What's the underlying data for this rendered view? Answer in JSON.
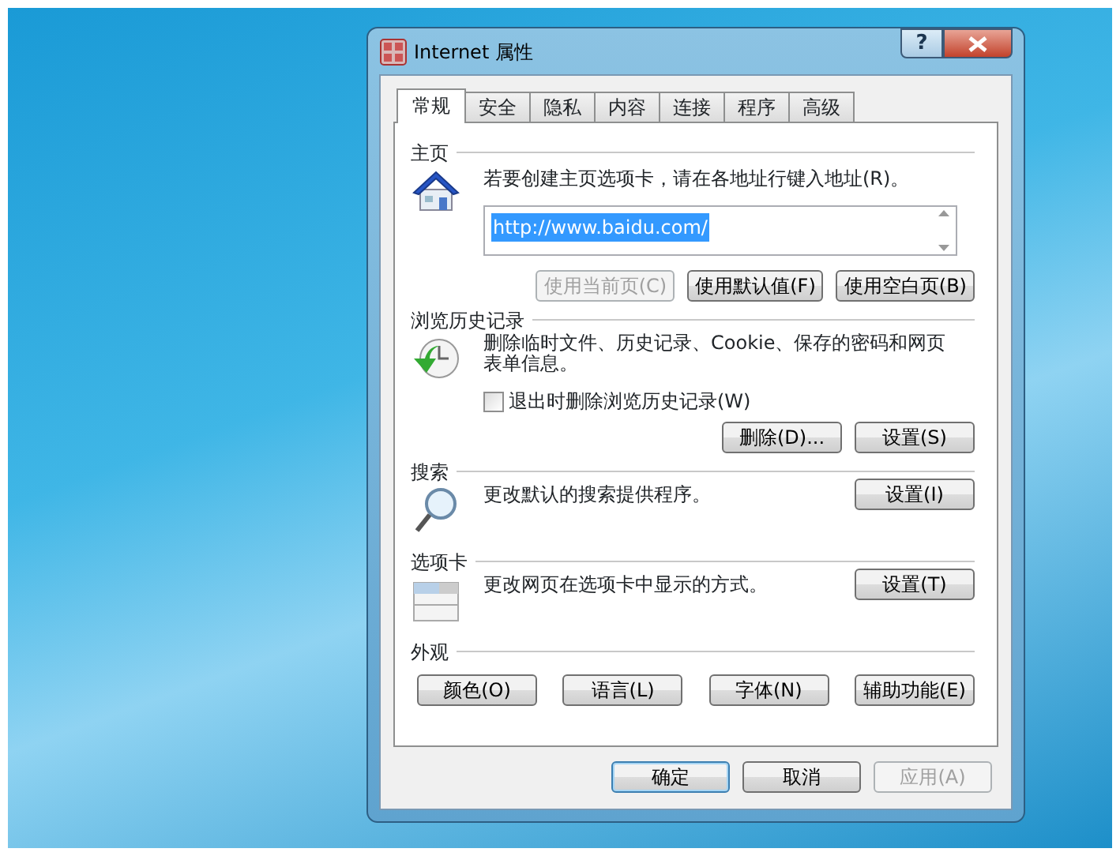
{
  "window": {
    "title": "Internet 属性",
    "help_button": "?"
  },
  "tabs": [
    {
      "label": "常规",
      "selected": true
    },
    {
      "label": "安全",
      "selected": false
    },
    {
      "label": "隐私",
      "selected": false
    },
    {
      "label": "内容",
      "selected": false
    },
    {
      "label": "连接",
      "selected": false
    },
    {
      "label": "程序",
      "selected": false
    },
    {
      "label": "高级",
      "selected": false
    }
  ],
  "sections": [
    {
      "kind": "homepage",
      "heading": "主页",
      "description": "若要创建主页选项卡，请在各地址行键入地址(R)。",
      "url": "http://www.baidu.com/",
      "buttons": [
        {
          "label": "使用当前页(C)",
          "disabled": true
        },
        {
          "label": "使用默认值(F)",
          "disabled": false
        },
        {
          "label": "使用空白页(B)",
          "disabled": false
        }
      ]
    },
    {
      "kind": "history",
      "heading": "浏览历史记录",
      "description": "删除临时文件、历史记录、Cookie、保存的密码和网页表单信息。",
      "checkbox": {
        "label": "退出时删除浏览历史记录(W)",
        "checked": false
      },
      "buttons": [
        {
          "label": "删除(D)...",
          "disabled": false
        },
        {
          "label": "设置(S)",
          "disabled": false
        }
      ]
    },
    {
      "kind": "search",
      "heading": "搜索",
      "description": "更改默认的搜索提供程序。",
      "buttons": [
        {
          "label": "设置(I)",
          "disabled": false
        }
      ]
    },
    {
      "kind": "tabs",
      "heading": "选项卡",
      "description": "更改网页在选项卡中显示的方式。",
      "buttons": [
        {
          "label": "设置(T)",
          "disabled": false
        }
      ]
    },
    {
      "kind": "appearance",
      "heading": "外观",
      "buttons": [
        {
          "label": "颜色(O)",
          "disabled": false
        },
        {
          "label": "语言(L)",
          "disabled": false
        },
        {
          "label": "字体(N)",
          "disabled": false
        },
        {
          "label": "辅助功能(E)",
          "disabled": false
        }
      ]
    }
  ],
  "footer_buttons": [
    {
      "label": "确定",
      "default": true,
      "disabled": false
    },
    {
      "label": "取消",
      "default": false,
      "disabled": false
    },
    {
      "label": "应用(A)",
      "default": false,
      "disabled": true
    }
  ]
}
